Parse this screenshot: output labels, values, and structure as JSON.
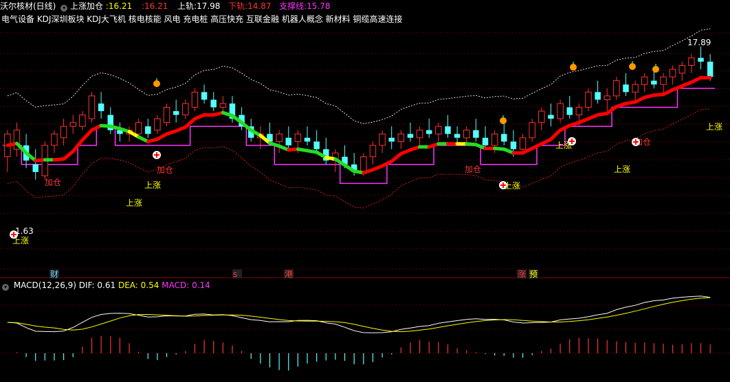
{
  "header": {
    "stock_name": "沃尔核材(日线)",
    "indicator_name": "上涨加仓",
    "value_a": ":16.21",
    "value_b": ":16.21",
    "upper_label": "上轨:",
    "upper_value": "17.98",
    "lower_label": "下轨:",
    "lower_value": "14.87",
    "support_label": "支撑线:",
    "support_value": "15.78"
  },
  "concepts": "电气设备  KDJ深圳板块  KDJ大飞机 核电核能 风电 充电桩 高压快充 互联金融 机器人概念 新材料 铜缆高速连接",
  "annotations": {
    "high_price": "17.89",
    "low_price": "1.63",
    "up_label": "上涨",
    "add_label": "加仓",
    "event_cai": "财",
    "event_s": "s",
    "event_gang": "港",
    "event_zhang": "涨",
    "event_yu": "预"
  },
  "macd": {
    "title": "MACD(12,26,9)",
    "dif_label": "DIF:",
    "dif_value": "0.61",
    "dea_label": "DEA:",
    "dea_value": "0.54",
    "macd_label": "MACD:",
    "macd_value": "0.14"
  },
  "chart_data": [
    {
      "type": "candlestick",
      "title": "沃尔核材(日线)",
      "price_range": [
        13.0,
        18.4
      ],
      "candles": [
        [
          16.2,
          16.9,
          15.8,
          16.8
        ],
        [
          16.4,
          17.1,
          16.2,
          16.9
        ],
        [
          16.5,
          16.8,
          15.9,
          16.1
        ],
        [
          16.0,
          16.4,
          15.6,
          15.8
        ],
        [
          15.7,
          16.6,
          15.6,
          16.5
        ],
        [
          16.5,
          16.9,
          16.3,
          16.8
        ],
        [
          16.7,
          17.2,
          16.5,
          17.0
        ],
        [
          17.0,
          17.3,
          16.8,
          17.1
        ],
        [
          17.0,
          17.4,
          16.9,
          17.3
        ],
        [
          17.2,
          17.9,
          17.1,
          17.8
        ],
        [
          17.6,
          17.9,
          17.2,
          17.4
        ],
        [
          17.3,
          17.5,
          16.8,
          16.9
        ],
        [
          16.9,
          17.1,
          16.6,
          16.8
        ],
        [
          16.8,
          17.0,
          16.6,
          16.9
        ],
        [
          16.8,
          17.2,
          16.7,
          17.1
        ],
        [
          17.0,
          17.2,
          16.7,
          16.8
        ],
        [
          16.9,
          17.3,
          16.8,
          17.2
        ],
        [
          17.1,
          17.6,
          17.0,
          17.5
        ],
        [
          17.4,
          17.7,
          17.1,
          17.3
        ],
        [
          17.3,
          17.7,
          17.2,
          17.6
        ],
        [
          17.5,
          18.0,
          17.4,
          17.9
        ],
        [
          17.9,
          18.1,
          17.6,
          17.7
        ],
        [
          17.7,
          17.9,
          17.4,
          17.5
        ],
        [
          17.5,
          17.8,
          17.3,
          17.6
        ],
        [
          17.6,
          17.8,
          17.1,
          17.2
        ],
        [
          17.3,
          17.5,
          16.9,
          17.0
        ],
        [
          17.0,
          17.2,
          16.6,
          16.7
        ],
        [
          16.7,
          17.0,
          16.4,
          16.8
        ],
        [
          16.8,
          17.1,
          16.5,
          16.6
        ],
        [
          16.6,
          16.9,
          16.3,
          16.8
        ],
        [
          16.7,
          17.0,
          16.4,
          16.5
        ],
        [
          16.6,
          16.9,
          16.3,
          16.8
        ],
        [
          16.7,
          17.0,
          16.5,
          16.6
        ],
        [
          16.6,
          16.9,
          16.3,
          16.4
        ],
        [
          16.4,
          16.7,
          16.0,
          16.1
        ],
        [
          16.1,
          16.4,
          15.8,
          16.3
        ],
        [
          16.2,
          16.5,
          15.9,
          16.0
        ],
        [
          16.0,
          16.3,
          15.7,
          15.8
        ],
        [
          15.8,
          16.3,
          15.7,
          16.2
        ],
        [
          16.2,
          16.6,
          16.0,
          16.5
        ],
        [
          16.5,
          16.9,
          16.3,
          16.8
        ],
        [
          16.7,
          17.0,
          16.4,
          16.6
        ],
        [
          16.6,
          16.9,
          16.4,
          16.8
        ],
        [
          16.8,
          17.1,
          16.6,
          16.7
        ],
        [
          16.7,
          17.0,
          16.5,
          16.9
        ],
        [
          16.9,
          17.2,
          16.7,
          16.8
        ],
        [
          16.8,
          17.1,
          16.6,
          17.0
        ],
        [
          17.0,
          17.3,
          16.7,
          16.8
        ],
        [
          16.8,
          17.0,
          16.5,
          16.7
        ],
        [
          16.7,
          17.0,
          16.5,
          16.9
        ],
        [
          16.9,
          17.2,
          16.6,
          16.7
        ],
        [
          16.7,
          17.0,
          16.4,
          16.5
        ],
        [
          16.5,
          16.9,
          16.3,
          16.8
        ],
        [
          16.8,
          17.1,
          16.5,
          16.6
        ],
        [
          16.6,
          16.9,
          16.2,
          16.4
        ],
        [
          16.4,
          16.8,
          16.3,
          16.7
        ],
        [
          16.7,
          17.2,
          16.6,
          17.1
        ],
        [
          17.1,
          17.5,
          16.9,
          17.4
        ],
        [
          17.3,
          17.6,
          17.0,
          17.2
        ],
        [
          17.2,
          17.7,
          17.1,
          17.6
        ],
        [
          17.5,
          17.8,
          17.2,
          17.3
        ],
        [
          17.3,
          17.6,
          17.0,
          17.5
        ],
        [
          17.5,
          18.0,
          17.4,
          17.9
        ],
        [
          17.9,
          18.2,
          17.6,
          17.7
        ],
        [
          17.7,
          18.0,
          17.4,
          17.8
        ],
        [
          17.8,
          18.3,
          17.7,
          18.2
        ],
        [
          18.1,
          18.4,
          17.8,
          17.9
        ],
        [
          17.9,
          18.2,
          17.6,
          18.1
        ],
        [
          18.1,
          18.4,
          17.9,
          18.3
        ],
        [
          18.2,
          18.5,
          18.0,
          18.1
        ],
        [
          18.1,
          18.4,
          17.8,
          18.3
        ],
        [
          18.3,
          18.6,
          18.1,
          18.5
        ],
        [
          18.4,
          18.7,
          18.2,
          18.6
        ],
        [
          18.6,
          18.9,
          18.4,
          18.8
        ],
        [
          18.8,
          19.1,
          18.5,
          18.7
        ],
        [
          18.7,
          18.9,
          18.2,
          18.3
        ]
      ]
    },
    {
      "type": "line",
      "title": "MACD(12,26,9)",
      "series": [
        {
          "name": "DIF",
          "value": 0.61
        },
        {
          "name": "DEA",
          "value": 0.54
        },
        {
          "name": "MACD",
          "value": 0.14
        }
      ]
    }
  ],
  "colors": {
    "up": "#ff3333",
    "down": "#54ffff",
    "thick_line": "#ff0000",
    "support": "#ff33ff",
    "upper_band": "#dddddd",
    "lower_band": "#cc2222",
    "dif": "#ffffff",
    "dea": "#ffff00",
    "text_yellow": "#ffff00",
    "text_red": "#ff3333",
    "text_white": "#ffffff",
    "text_magenta": "#ff33ff"
  }
}
